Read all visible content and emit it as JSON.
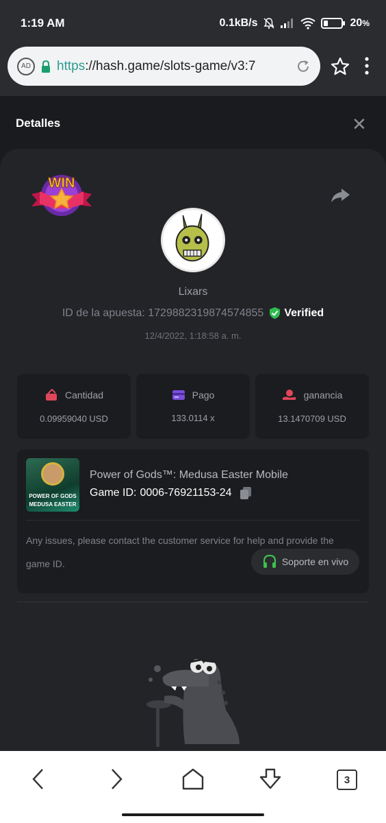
{
  "status_bar": {
    "time": "1:19 AM",
    "network_speed": "0.1kB/s",
    "battery": "20",
    "battery_suffix": "%"
  },
  "browser": {
    "url_scheme": "https",
    "url_rest": "://hash.game/slots-game/v3:7",
    "tabs_count": "3"
  },
  "dialog": {
    "title": "Detalles"
  },
  "bet": {
    "username": "Lixars",
    "bet_id_label": "ID de la apuesta: 1729882319874574855",
    "verified_label": "Verified",
    "date": "12/4/2022, 1:18:58 a. m.",
    "stats": [
      {
        "label": "Cantidad",
        "value": "0.09959040 USD",
        "icon": "bet-amount-icon",
        "color": "#e0465a"
      },
      {
        "label": "Pago",
        "value": "133.0114 x",
        "icon": "payout-card-icon",
        "color": "#7b4fe0"
      },
      {
        "label": "ganancia",
        "value": "13.1470709 USD",
        "icon": "profit-hand-icon",
        "color": "#e0465a"
      }
    ]
  },
  "game": {
    "name": "Power of Gods™: Medusa Easter Mobile",
    "id_label": "Game ID:",
    "id_value": "0006-76921153-24",
    "thumb_line1": "POWER OF GODS",
    "thumb_line2": "MEDUSA EASTER",
    "notice_line1": "Any issues, please contact the customer service for help and provide the",
    "notice_line2": "game ID.",
    "support_label": "Soporte en vivo"
  },
  "colors": {
    "verified_green": "#2ebd4f",
    "support_green": "#3cc24f"
  }
}
